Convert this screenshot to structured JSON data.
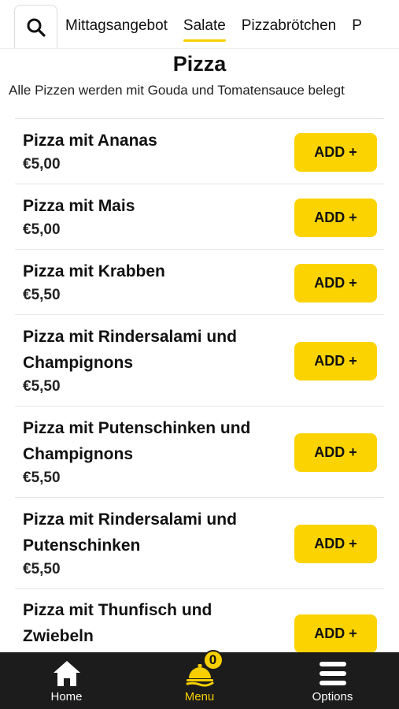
{
  "categories": {
    "tabs": [
      {
        "label": "Mittagsangebot",
        "active": false
      },
      {
        "label": "Salate",
        "active": true
      },
      {
        "label": "Pizzabrötchen",
        "active": false
      },
      {
        "label": "P",
        "active": false
      }
    ],
    "search_icon": "search-icon"
  },
  "section": {
    "title": "Pizza",
    "description": "Alle Pizzen werden mit Gouda und Tomatensauce belegt"
  },
  "items": [
    {
      "name": "Pizza mit Ananas",
      "price": "€5,00",
      "button": "ADD +"
    },
    {
      "name": "Pizza mit Mais",
      "price": "€5,00",
      "button": "ADD +"
    },
    {
      "name": "Pizza mit Krabben",
      "price": "€5,50",
      "button": "ADD +"
    },
    {
      "name": "Pizza mit Rindersalami und Champignons",
      "price": "€5,50",
      "button": "ADD +"
    },
    {
      "name": "Pizza mit Putenschinken und Champignons",
      "price": "€5,50",
      "button": "ADD +"
    },
    {
      "name": "Pizza mit Rindersalami und Putenschinken",
      "price": "€5,50",
      "button": "ADD +"
    },
    {
      "name": "Pizza mit Thunfisch und Zwiebeln",
      "price": "",
      "button": "ADD +"
    }
  ],
  "bottom_nav": {
    "home_label": "Home",
    "menu_label": "Menu",
    "options_label": "Options",
    "cart_count": "0"
  },
  "colors": {
    "accent": "#f6cf00",
    "nav_background": "#1c1c1c"
  }
}
